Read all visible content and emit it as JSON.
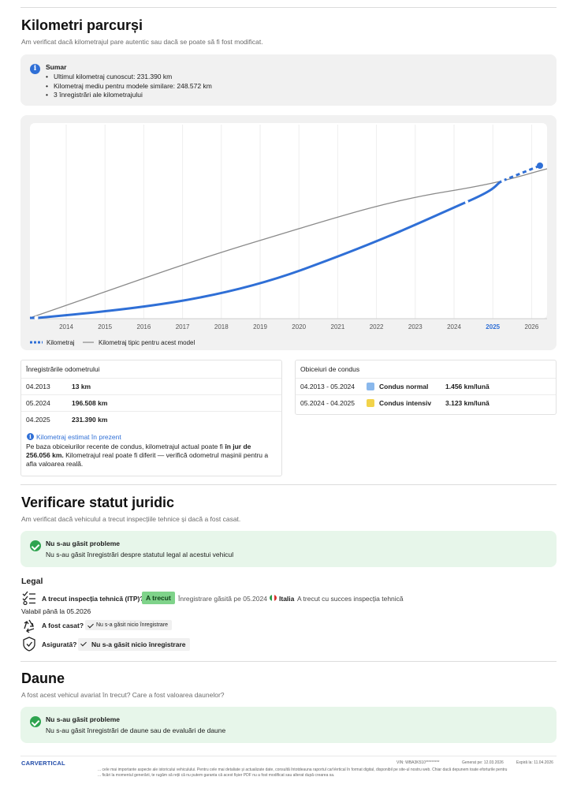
{
  "mileage": {
    "title": "Kilometri parcurși",
    "subtitle": "Am verificat dacă kilometrajul pare autentic sau dacă se poate să fi fost modificat.",
    "summary": {
      "heading": "Sumar",
      "items": [
        "Ultimul kilometraj cunoscut: 231.390 km",
        "Kilometraj mediu pentru modele similare: 248.572 km",
        "3 înregistrări ale kilometrajului"
      ]
    },
    "chart_data": {
      "type": "line",
      "x_ticks": [
        "2014",
        "2015",
        "2016",
        "2017",
        "2018",
        "2019",
        "2020",
        "2021",
        "2022",
        "2023",
        "2024",
        "2025",
        "2026"
      ],
      "highlight_tick": "2025",
      "series": [
        {
          "name": "Kilometraj",
          "color": "#2f6fd6",
          "style": "solid with dots; dashed estimate",
          "points": [
            {
              "x": "04.2013",
              "y": 13
            },
            {
              "x": "05.2024",
              "y": 196508
            },
            {
              "x": "04.2025",
              "y": 231390
            }
          ],
          "estimate": {
            "x": "prezent",
            "y": 256056
          }
        },
        {
          "name": "Kilometraj tipic pentru acest model",
          "color": "#888888",
          "style": "solid"
        }
      ],
      "grid": true,
      "legend": "bottom-left"
    },
    "legend": {
      "mileage": "Kilometraj",
      "typical": "Kilometraj tipic pentru acest model"
    },
    "records": {
      "heading": "Înregistrările odometrului",
      "rows": [
        {
          "date": "04.2013",
          "km": "13 km"
        },
        {
          "date": "05.2024",
          "km": "196.508 km"
        },
        {
          "date": "04.2025",
          "km": "231.390 km"
        }
      ],
      "estimate_title": "Kilometraj estimat în prezent",
      "estimate_pre": "Pe baza obiceiurilor recente de condus, kilometrajul actual poate fi",
      "estimate_bold": "în jur de 256.056 km.",
      "estimate_post": "Kilometrajul real poate fi diferit — verifică odometrul mașinii pentru a afla valoarea reală."
    },
    "habits": {
      "heading": "Obiceiuri de condus",
      "rows": [
        {
          "period": "04.2013 - 05.2024",
          "label": "Condus normal",
          "rate": "1.456 km/lună",
          "color": "#8ab8ec"
        },
        {
          "period": "05.2024 - 04.2025",
          "label": "Condus intensiv",
          "rate": "3.123 km/lună",
          "color": "#f2d34a"
        }
      ]
    }
  },
  "legal": {
    "title": "Verificare statut juridic",
    "subtitle": "Am verificat dacă vehiculul a trecut inspecțiile tehnice și dacă a fost casat.",
    "ok_title": "Nu s-au găsit probleme",
    "ok_text": "Nu s-au găsit înregistrări despre statutul legal al acestui vehicul",
    "section": "Legal",
    "itp": {
      "question": "A trecut inspecția tehnică (ITP)?",
      "badge": "A trecut",
      "found": "Înregistrare găsită pe 05.2024",
      "country": "Italia",
      "result": "A trecut cu succes inspecția tehnică",
      "valid": "Valabil până la 05.2026"
    },
    "scrapped": {
      "question": "A fost casat?",
      "badge": "Nu s-a găsit nicio înregistrare"
    },
    "insured": {
      "question": "Asigurată?",
      "badge": "Nu s-a găsit nicio înregistrare"
    }
  },
  "damage": {
    "title": "Daune",
    "subtitle": "A fost acest vehicul avariat în trecut? Care a fost valoarea daunelor?",
    "ok_title": "Nu s-au găsit probleme",
    "ok_text": "Nu s-au găsit înregistrări de daune sau de evaluări de daune"
  },
  "footer": {
    "brand": "CARVERTICAL",
    "vin": "VIN: WBA3K510*********",
    "generated": "Generat pe: 12.03.2026",
    "expires": "Expiră la: 11.04.2026",
    "disclaimer_1": "... cele mai importante aspecte ale istoricului vehiculului. Pentru cele mai detaliate și actualizate date, consultă întotdeauna raportul carVertical în format digital, disponibil pe site-ul nostru web. Chiar dacă depunem toate eforturile pentru",
    "disclaimer_2": "... ficări la momentul generării, te rugăm să reții că nu putem garanta că acest fișier PDF nu a fost modificat sau alterat după crearea sa."
  }
}
